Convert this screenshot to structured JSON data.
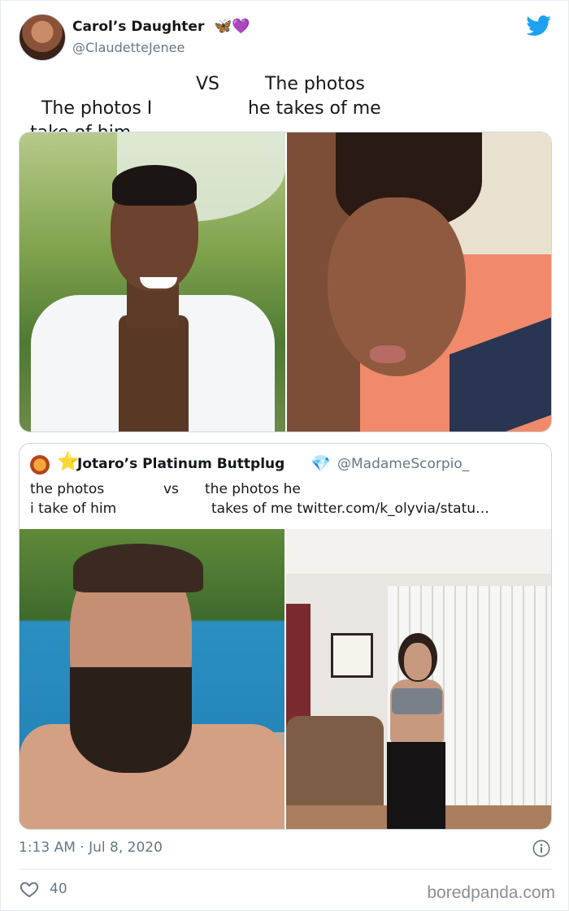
{
  "tweet": {
    "display_name": "Carol’s Daughter",
    "display_name_emoji": "🦋💜",
    "handle": "@ClaudetteJenee",
    "text_left": "The photos I\n  take of him",
    "text_vs": "VS",
    "text_right": "   The photos\nhe takes of me",
    "timestamp": "1:13 AM · Jul 8, 2020",
    "likes": "40",
    "icons": [
      "twitter-bird-icon",
      "info-icon",
      "heart-icon"
    ],
    "brand_color": "#1da1f2"
  },
  "quoted_tweet": {
    "star": "⭐",
    "display_name": "Jotaro’s Platinum Buttplug",
    "gem": "💎",
    "handle": "@MadameScorpio_",
    "line1_left": "the photos",
    "line1_vs": "vs",
    "line1_right": "the photos he",
    "line2_left": "i take of him",
    "line2_right": "takes of me twitter.com/k_olyvia/statu…"
  },
  "watermark": "boredpanda.com"
}
